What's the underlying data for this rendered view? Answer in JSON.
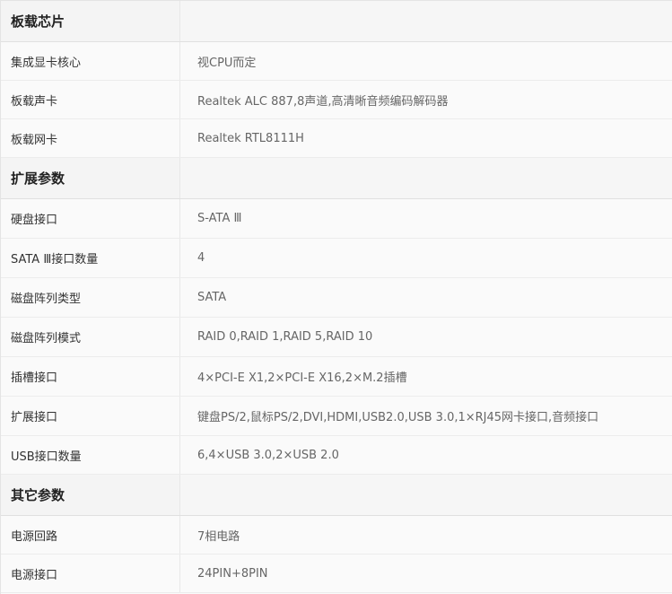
{
  "sections": [
    {
      "title": "板载芯片",
      "rows": [
        {
          "key": "集成显卡核心",
          "value": "视CPU而定"
        },
        {
          "key": "板载声卡",
          "value": "Realtek ALC 887,8声道,高清晰音频编码解码器"
        },
        {
          "key": "板载网卡",
          "value": "Realtek RTL8111H"
        }
      ]
    },
    {
      "title": "扩展参数",
      "rows": [
        {
          "key": "硬盘接口",
          "value": "S-ATA Ⅲ"
        },
        {
          "key": "SATA Ⅲ接口数量",
          "value": "4"
        },
        {
          "key": "磁盘阵列类型",
          "value": "SATA"
        },
        {
          "key": "磁盘阵列模式",
          "value": "RAID 0,RAID 1,RAID 5,RAID 10"
        },
        {
          "key": "插槽接口",
          "value": "4×PCI-E X1,2×PCI-E X16,2×M.2插槽"
        },
        {
          "key": "扩展接口",
          "value": "键盘PS/2,鼠标PS/2,DVI,HDMI,USB2.0,USB 3.0,1×RJ45网卡接口,音频接口"
        },
        {
          "key": "USB接口数量",
          "value": "6,4×USB 3.0,2×USB 2.0"
        }
      ]
    },
    {
      "title": "其它参数",
      "rows": [
        {
          "key": "电源回路",
          "value": "7相电路"
        },
        {
          "key": "电源接口",
          "value": "24PIN+8PIN"
        }
      ]
    }
  ]
}
